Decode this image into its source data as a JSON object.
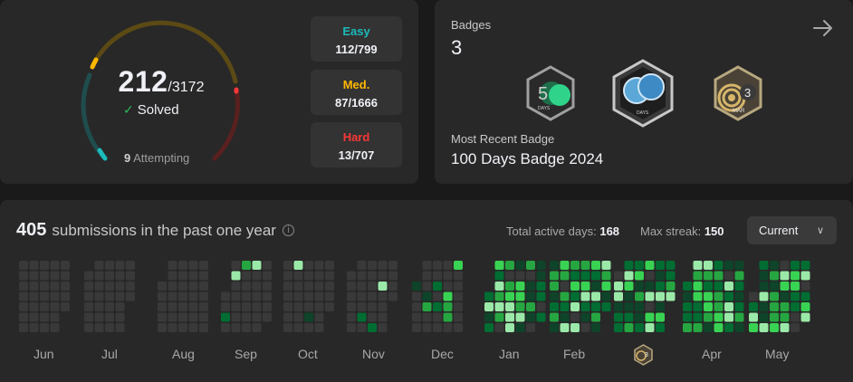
{
  "progress": {
    "solved": "212",
    "total": "/3172",
    "solved_label": "Solved",
    "attempting_count": "9",
    "attempting_label": "Attempting",
    "solved_fraction": 0.0668,
    "difficulties": [
      {
        "label": "Easy",
        "value": "112/799",
        "color": "#1cbaba"
      },
      {
        "label": "Med.",
        "value": "87/1666",
        "color": "#ffb700"
      },
      {
        "label": "Hard",
        "value": "13/707",
        "color": "#f63737"
      }
    ]
  },
  "badges": {
    "label": "Badges",
    "count": "3",
    "items": [
      {
        "name": "50-days-badge-icon",
        "text": "DAYS",
        "number": "50"
      },
      {
        "name": "100-days-badge-icon",
        "text": "DAYS",
        "number": "100"
      },
      {
        "name": "march-badge-icon",
        "text": "MAR",
        "number": "3"
      }
    ],
    "recent_label": "Most Recent Badge",
    "recent_name": "100 Days Badge 2024"
  },
  "submissions": {
    "count": "405",
    "title": "submissions in the past one year",
    "active_days_label": "Total active days:",
    "active_days": "168",
    "max_streak_label": "Max streak:",
    "max_streak": "150",
    "dropdown_value": "Current",
    "months": [
      "Jun",
      "Jul",
      "Aug",
      "Sep",
      "Oct",
      "Nov",
      "Dec",
      "Jan",
      "Feb",
      "Mar",
      "Apr",
      "May"
    ],
    "colors": {
      "empty": "#393939",
      "l1": "#0e4429",
      "l2": "#006d32",
      "l3": "#26a641",
      "l4": "#39d353",
      "l5": "#9be9a8"
    }
  }
}
